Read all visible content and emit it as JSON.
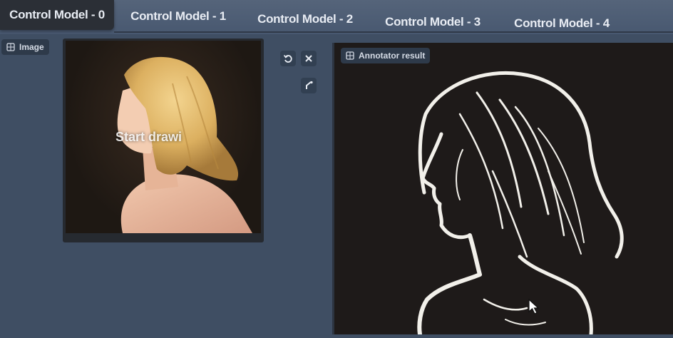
{
  "tabs": [
    {
      "label": "Control Model - 0",
      "active": true
    },
    {
      "label": "Control Model - 1",
      "active": false
    },
    {
      "label": "Control Model - 2",
      "active": false
    },
    {
      "label": "Control Model - 3",
      "active": false
    },
    {
      "label": "Control Model - 4",
      "active": false
    }
  ],
  "image_panel": {
    "label": "Image",
    "overlay_text": "Start drawi",
    "icon": "image-icon"
  },
  "tools": {
    "reset_icon": "undo-icon",
    "close_icon": "close-icon",
    "brush_icon": "brush-icon"
  },
  "annotator_panel": {
    "label": "Annotator result",
    "icon": "image-icon"
  },
  "colors": {
    "background": "#3f4e63",
    "active_tab": "#2b2f36",
    "annotator_bg": "#1e1a19",
    "sketch_line": "#f2f0ea"
  }
}
